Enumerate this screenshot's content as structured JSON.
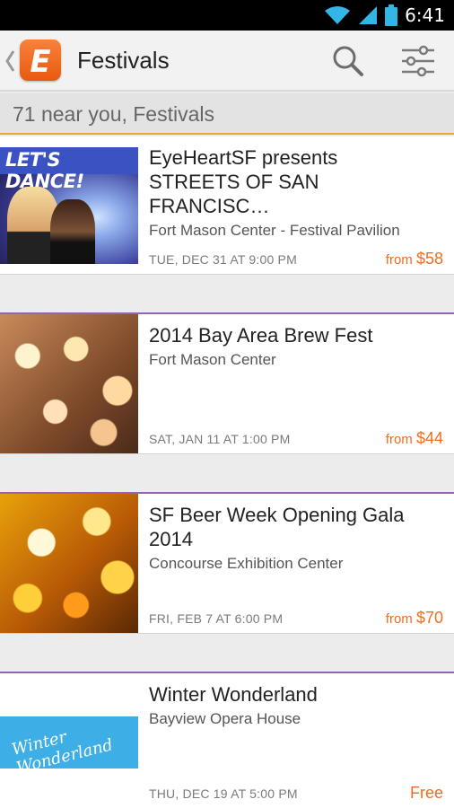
{
  "status_bar": {
    "time": "6:41",
    "icons": [
      "wifi-icon",
      "signal-icon",
      "battery-icon"
    ]
  },
  "action_bar": {
    "title": "Festivals",
    "icons": [
      "up-caret-icon",
      "eventbrite-logo-icon",
      "search-icon",
      "filter-sliders-icon"
    ]
  },
  "subheader": {
    "text": "71 near you, Festivals"
  },
  "events": [
    {
      "title": "EyeHeartSF presents\nSTREETS OF SAN FRANCISC…",
      "venue": "Fort Mason Center - Festival Pavilion",
      "date": "TUE, DEC 31 AT 9:00 PM",
      "price_prefix": "from",
      "price": "$58",
      "thumb_text": "LET'S DANCE!"
    },
    {
      "title": "2014 Bay Area Brew Fest",
      "venue": "Fort Mason Center",
      "date": "SAT, JAN 11 AT 1:00 PM",
      "price_prefix": "from",
      "price": "$44"
    },
    {
      "title": "SF Beer Week Opening Gala\n2014",
      "venue": "Concourse Exhibition Center",
      "date": "FRI, FEB 7 AT 6:00 PM",
      "price_prefix": "from",
      "price": "$70"
    },
    {
      "title": "Winter Wonderland",
      "venue": "Bayview Opera House",
      "date": "THU, DEC 19 AT 5:00 PM",
      "price_prefix": "",
      "price": "Free",
      "thumb_text": "Winter Wonderland"
    }
  ],
  "colors": {
    "accent": "#f36c21",
    "card_divider": "#9363b5",
    "subheader_rule": "#f0a81f"
  }
}
